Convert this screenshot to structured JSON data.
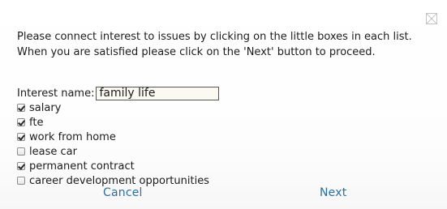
{
  "dialog": {
    "instructions": "Please connect interest to issues by clicking on the little boxes in each list. When you are satisfied please click on the 'Next' button to proceed.",
    "close_icon": "close-icon"
  },
  "interest": {
    "label": "Interest name:",
    "value": "family life"
  },
  "issues": [
    {
      "label": "salary",
      "checked": true
    },
    {
      "label": "fte",
      "checked": true
    },
    {
      "label": "work from home",
      "checked": true
    },
    {
      "label": "lease car",
      "checked": false
    },
    {
      "label": "permanent contract",
      "checked": true
    },
    {
      "label": "career development opportunities",
      "checked": false
    }
  ],
  "buttons": {
    "cancel_label": "Cancel",
    "next_label": "Next"
  },
  "colors": {
    "link_button": "#2b6f9e",
    "input_background": "#fbfaf2"
  }
}
